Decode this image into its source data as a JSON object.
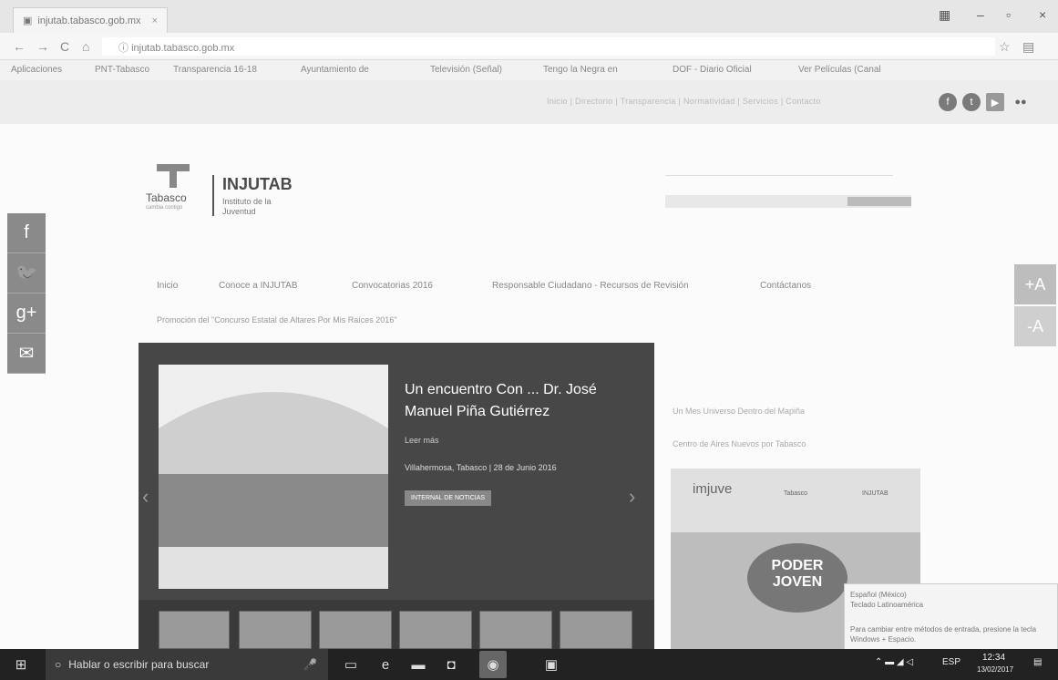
{
  "browser": {
    "tab_title": "injutab.tabasco.gob.mx",
    "url": "injutab.tabasco.gob.mx",
    "bookmarks": [
      "Aplicaciones",
      "PNT-Tabasco",
      "Transparencia 16-18",
      "Ayuntamiento de",
      "Televisión (Señal)",
      "Tengo la Negra en",
      "DOF - Diario Oficial",
      "Ver Películas (Canal"
    ]
  },
  "site": {
    "top_links": "Inicio | Directorio | Transparencia | Normatividad | Servicios | Contacto",
    "brand_state": "Tabasco",
    "brand_state_sub": "cambia contigo",
    "brand": "INJUTAB",
    "brand_sub": "Instituto de la Juventud",
    "menu": [
      "Inicio",
      "Conoce a INJUTAB",
      "Convocatorias 2016",
      "Responsable Ciudadano - Recursos de Revisión",
      "Contáctanos"
    ],
    "promo": "Promoción del \"Concurso Estatal de Altares Por Mis Raíces 2016\"",
    "share_icons": [
      "facebook-icon",
      "twitter-icon",
      "google-plus-icon",
      "mail-icon"
    ],
    "font_plus": "+A",
    "font_minus": "-A"
  },
  "slider": {
    "title": "Un encuentro Con ... Dr. José Manuel Piña Gutiérrez",
    "meta": "Leer más",
    "location": "Villahermosa, Tabasco | 28 de Junio 2016",
    "button": "INTERNAL DE NOTICIAS"
  },
  "sidebar": {
    "links": [
      "Un Mes Universo Dentro del Mapiña",
      "Centro de Aires Nuevos por Tabasco"
    ],
    "banner_logos": [
      "imjuve",
      "Tabasco",
      "INJUTAB"
    ],
    "banner_text": "PODER JOVEN"
  },
  "tooltip": {
    "line1": "Español (México)",
    "line2": "Teclado Latinoamérica",
    "line3": "Para cambiar entre métodos de entrada, presione la tecla Windows + Espacio."
  },
  "taskbar": {
    "search": "Hablar o escribir para buscar",
    "lang": "ESP",
    "time": "12:34",
    "date": "13/02/2017"
  }
}
